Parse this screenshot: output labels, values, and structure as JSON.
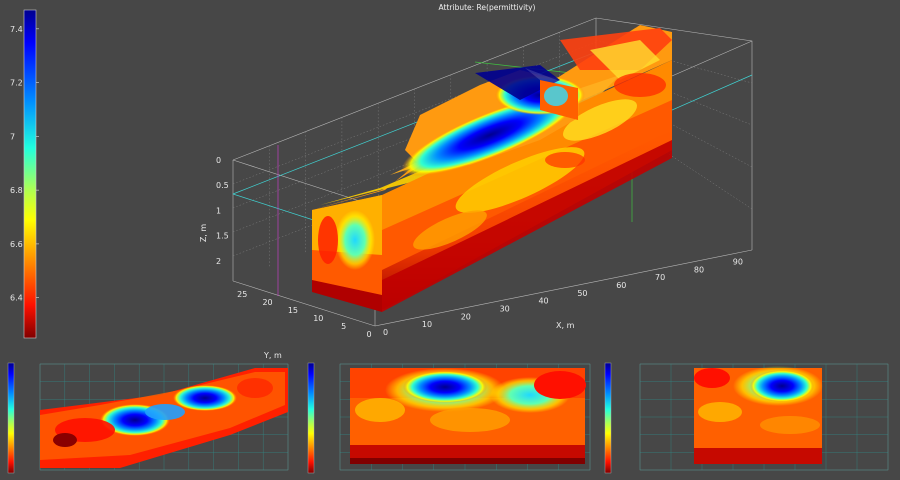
{
  "chart_data": [
    {
      "type": "heatmap",
      "subtype": "3d-volume-slices",
      "title": "Attribute: Re(permittivity)",
      "colormap": "jet",
      "colorbar": {
        "ticks": [
          "7.4",
          "7.2",
          "7",
          "6.8",
          "6.6",
          "6.4"
        ],
        "tick_values": [
          7.4,
          7.2,
          7.0,
          6.8,
          6.6,
          6.4
        ],
        "range": [
          6.25,
          7.47
        ]
      },
      "axes": {
        "x": {
          "label": "X, m",
          "ticks": [
            "0",
            "10",
            "20",
            "30",
            "40",
            "50",
            "60",
            "70",
            "80",
            "90"
          ],
          "range": [
            0,
            97
          ]
        },
        "y": {
          "ticks": [
            "0",
            "5",
            "10",
            "15",
            "20",
            "25"
          ],
          "range": [
            0,
            28
          ]
        },
        "z": {
          "label": "Z, m",
          "ticks": [
            "0",
            "0.5",
            "1",
            "1.5",
            "2"
          ],
          "range": [
            0,
            2.4
          ],
          "inverted": true
        }
      },
      "grid": true
    },
    {
      "type": "heatmap",
      "subtype": "plan-view-slice",
      "axes": {
        "y": {
          "label": "Y, m"
        }
      },
      "colormap": "jet",
      "grid": true
    },
    {
      "type": "heatmap",
      "subtype": "section-slice",
      "colormap": "jet",
      "grid": true
    },
    {
      "type": "heatmap",
      "subtype": "section-slice",
      "colormap": "jet",
      "grid": true
    }
  ]
}
